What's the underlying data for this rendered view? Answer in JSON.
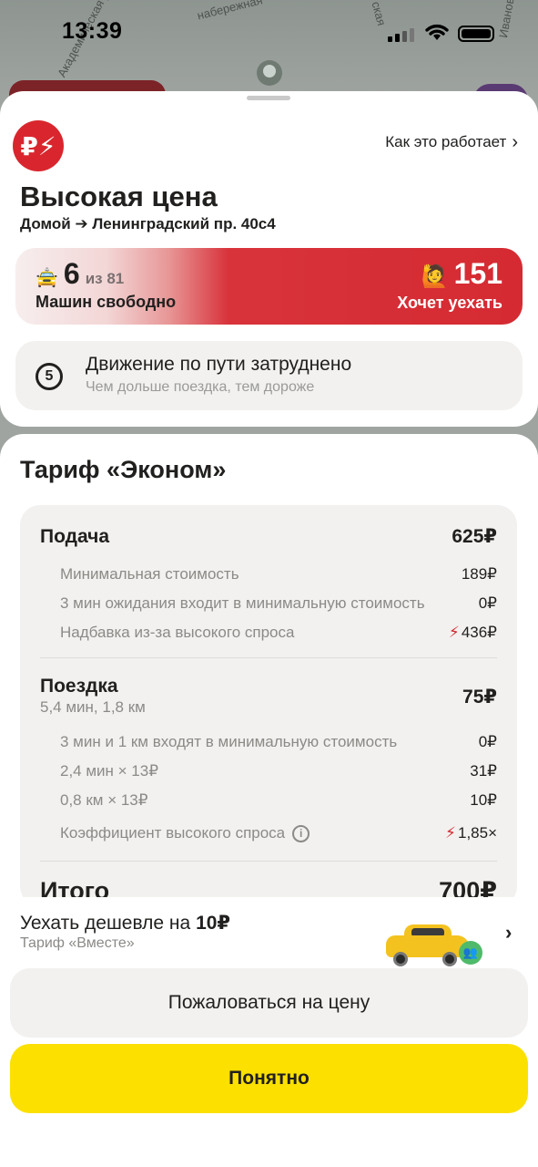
{
  "status_bar": {
    "time": "13:39"
  },
  "map": {
    "streets": [
      "Академическая ул.",
      "набережная",
      "Ивановская ул.",
      "ская"
    ]
  },
  "header": {
    "badge_glyph": "₽⚡",
    "how_link": "Как это работает",
    "title": "Высокая цена",
    "route": "Домой ➔ Ленинградский пр. 40с4"
  },
  "demand": {
    "cars_free": "6",
    "cars_total": "из 81",
    "cars_label": "Машин свободно",
    "riders": "151",
    "riders_label": "Хочет уехать"
  },
  "traffic": {
    "level": "5",
    "title": "Движение по пути затруднено",
    "subtitle": "Чем дольше поездка, тем дороже"
  },
  "tariff": {
    "title": "Тариф «Эконом»",
    "pickup": {
      "label": "Подача",
      "amount": "625₽",
      "rows": [
        {
          "label": "Минимальная стоимость",
          "value": "189₽"
        },
        {
          "label": "3 мин ожидания входит в минимальную стоимость",
          "value": "0₽"
        },
        {
          "label": "Надбавка из-за высокого спроса",
          "value": "436₽"
        }
      ]
    },
    "ride": {
      "label": "Поездка",
      "details": "5,4 мин, 1,8 км",
      "amount": "75₽",
      "rows": [
        {
          "label": "3 мин и 1 км входят в минимальную стоимость",
          "value": "0₽"
        },
        {
          "label": "2,4 мин × 13₽",
          "value": "31₽"
        },
        {
          "label": "0,8 км × 13₽",
          "value": "10₽"
        },
        {
          "label": "Коэффициент высокого спроса",
          "value": "1,85×"
        }
      ]
    },
    "total": {
      "label": "Итого",
      "amount": "700₽"
    }
  },
  "cheaper": {
    "prefix": "Уехать дешевле на",
    "amount": "10₽",
    "tariff": "Тариф «Вместе»"
  },
  "buttons": {
    "complain": "Пожаловаться на цену",
    "ok": "Понятно"
  },
  "colors": {
    "accent_red": "#d52a32",
    "yellow": "#fce000",
    "card_bg": "#f2f1ef"
  }
}
